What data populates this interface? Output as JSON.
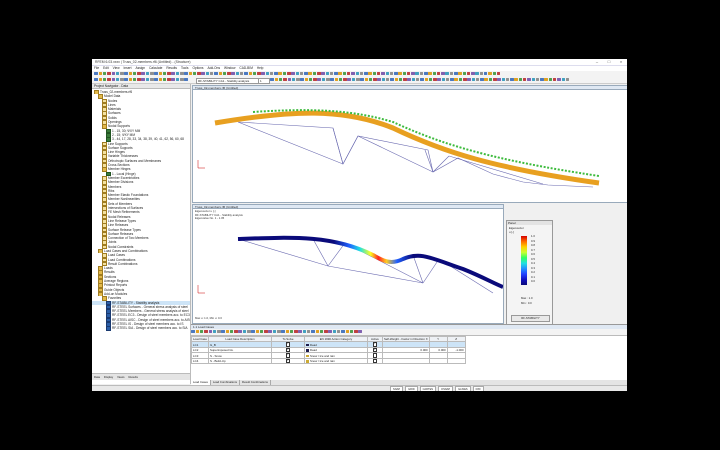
{
  "window": {
    "title": "RFEM 6.03.xxxx | Truss_02-members.rf6 (Untitled) - (Structure)"
  },
  "menu": [
    "File",
    "Edit",
    "View",
    "Insert",
    "Assign",
    "Calculate",
    "Results",
    "Tools",
    "Options",
    "Add-Ons",
    "Window",
    "CAD-BIM",
    "Help"
  ],
  "toolbar": {
    "combo1": "RF-STABILITY CA1 - Stability analysis",
    "combo2": "1"
  },
  "navigator": {
    "title": "Project Navigator - Data",
    "items": [
      {
        "label": "Truss_02-members.rf6",
        "indent": 0,
        "kind": "folder"
      },
      {
        "label": "Model Data",
        "indent": 1,
        "kind": "folder"
      },
      {
        "label": "Nodes",
        "indent": 2,
        "kind": "item"
      },
      {
        "label": "Lines",
        "indent": 2,
        "kind": "item"
      },
      {
        "label": "Materials",
        "indent": 2,
        "kind": "item"
      },
      {
        "label": "Surfaces",
        "indent": 2,
        "kind": "item"
      },
      {
        "label": "Solids",
        "indent": 2,
        "kind": "item"
      },
      {
        "label": "Openings",
        "indent": 2,
        "kind": "item"
      },
      {
        "label": "Nodal Supports",
        "indent": 2,
        "kind": "folder"
      },
      {
        "label": "1 - 15, 30; ΨXY MM",
        "indent": 3,
        "kind": "support"
      },
      {
        "label": "2 - 15; ΨXY MM",
        "indent": 3,
        "kind": "support"
      },
      {
        "label": "3 - 44, 17, 28, 33, 34, 38, 39, 40, 41, 62, 56, 60, 68",
        "indent": 3,
        "kind": "support"
      },
      {
        "label": "Line Supports",
        "indent": 2,
        "kind": "item"
      },
      {
        "label": "Surface Supports",
        "indent": 2,
        "kind": "item"
      },
      {
        "label": "Line Hinges",
        "indent": 2,
        "kind": "item"
      },
      {
        "label": "Variable Thicknesses",
        "indent": 2,
        "kind": "item"
      },
      {
        "label": "Orthotropic Surfaces and Membranes",
        "indent": 2,
        "kind": "item"
      },
      {
        "label": "Cross-Sections",
        "indent": 2,
        "kind": "item"
      },
      {
        "label": "Member Hinges",
        "indent": 2,
        "kind": "folder"
      },
      {
        "label": "1 - Local (Hinge)",
        "indent": 3,
        "kind": "support"
      },
      {
        "label": "Member Eccentricities",
        "indent": 2,
        "kind": "item"
      },
      {
        "label": "Member Divisions",
        "indent": 2,
        "kind": "item"
      },
      {
        "label": "Members",
        "indent": 2,
        "kind": "item"
      },
      {
        "label": "Ribs",
        "indent": 2,
        "kind": "item"
      },
      {
        "label": "Member Elastic Foundations",
        "indent": 2,
        "kind": "item"
      },
      {
        "label": "Member Nonlinearities",
        "indent": 2,
        "kind": "item"
      },
      {
        "label": "Sets of Members",
        "indent": 2,
        "kind": "item"
      },
      {
        "label": "Intersections of Surfaces",
        "indent": 2,
        "kind": "item"
      },
      {
        "label": "FE Mesh Refinements",
        "indent": 2,
        "kind": "item"
      },
      {
        "label": "Nodal Releases",
        "indent": 2,
        "kind": "item"
      },
      {
        "label": "Line Release Types",
        "indent": 2,
        "kind": "item"
      },
      {
        "label": "Line Releases",
        "indent": 2,
        "kind": "item"
      },
      {
        "label": "Surface Release Types",
        "indent": 2,
        "kind": "item"
      },
      {
        "label": "Surface Releases",
        "indent": 2,
        "kind": "item"
      },
      {
        "label": "Connection of Two Members",
        "indent": 2,
        "kind": "item"
      },
      {
        "label": "Joints",
        "indent": 2,
        "kind": "item"
      },
      {
        "label": "Nodal Constraints",
        "indent": 2,
        "kind": "item"
      },
      {
        "label": "Load Cases and Combinations",
        "indent": 1,
        "kind": "folder"
      },
      {
        "label": "Load Cases",
        "indent": 2,
        "kind": "item"
      },
      {
        "label": "Load Combinations",
        "indent": 2,
        "kind": "item"
      },
      {
        "label": "Result Combinations",
        "indent": 2,
        "kind": "item"
      },
      {
        "label": "Loads",
        "indent": 1,
        "kind": "folder"
      },
      {
        "label": "Results",
        "indent": 1,
        "kind": "folder"
      },
      {
        "label": "Sections",
        "indent": 1,
        "kind": "folder"
      },
      {
        "label": "Average Regions",
        "indent": 1,
        "kind": "folder"
      },
      {
        "label": "Printout Reports",
        "indent": 1,
        "kind": "folder"
      },
      {
        "label": "Guide Objects",
        "indent": 1,
        "kind": "folder"
      },
      {
        "label": "Add-on Modules",
        "indent": 1,
        "kind": "folder"
      },
      {
        "label": "Favorites",
        "indent": 2,
        "kind": "folder"
      },
      {
        "label": "RF-STABILITY - Stability analysis",
        "indent": 3,
        "kind": "module",
        "selected": true
      },
      {
        "label": "RF-STEEL Surfaces - General stress analysis of steel",
        "indent": 3,
        "kind": "module"
      },
      {
        "label": "RF-STEEL Members - General stress analysis of steel",
        "indent": 3,
        "kind": "module"
      },
      {
        "label": "RF-STEEL EC3 - Design of steel members acc. to EC3",
        "indent": 3,
        "kind": "module"
      },
      {
        "label": "RF-STEEL AISC - Design of steel members acc. to AISC",
        "indent": 3,
        "kind": "module"
      },
      {
        "label": "RF-STEEL IS - Design of steel members acc. to IS",
        "indent": 3,
        "kind": "module"
      },
      {
        "label": "RF-STEEL SIA - Design of steel members acc. to SIA",
        "indent": 3,
        "kind": "module"
      }
    ],
    "tabs": [
      "Data",
      "Display",
      "Views",
      "Results"
    ]
  },
  "view1": {
    "title": "Truss_02-members.rf6 (Untitled)"
  },
  "view2": {
    "title": "Truss_02-members.rf6 (Untitled)",
    "info": [
      "Eigenvector u [-]",
      "RF-STABILITY CA1 - Stability analysis",
      "Eigenvalue No. 1 - 1.05"
    ],
    "max_text": "Max u: 1.0, Min u: 0.0"
  },
  "panel": {
    "title": "Panel",
    "subtitle": "Eigenvector",
    "unit": "u [-]",
    "legend": [
      "1.0",
      "0.9",
      "0.8",
      "0.7",
      "0.6",
      "0.5",
      "0.4",
      "0.3",
      "0.2",
      "0.1",
      "0.0"
    ],
    "max_label": "Max :",
    "max_val": "1.0",
    "min_label": "Min :",
    "min_val": "0.0",
    "button": "RF-STABILITY"
  },
  "table": {
    "title": "1.1 Load Cases",
    "columns": [
      "Load Case",
      "Load Case Description",
      "To Solve",
      "EN 1990 Action Category",
      "Active",
      "Self-Weight - Factor in Direction X",
      "Y",
      "Z"
    ],
    "rows": [
      {
        "lc": "LC1",
        "desc": "G_B",
        "solve": true,
        "color": "#1c1c4c",
        "cat": "Dead",
        "active": true,
        "x": "",
        "y": "",
        "z": "",
        "selected": true
      },
      {
        "lc": "LC2",
        "desc": "Superimposed GL",
        "solve": true,
        "color": "#1c1c4c",
        "cat": "Dead",
        "active": true,
        "x": "0.000",
        "y": "0.000",
        "z": "-1.000"
      },
      {
        "lc": "LC3",
        "desc": "S - Snow",
        "solve": true,
        "color": "#ccaa33",
        "cat": "Snow / Ice and rain",
        "active": false,
        "x": "",
        "y": "",
        "z": ""
      },
      {
        "lc": "LC4",
        "desc": "S - Build-Up",
        "solve": true,
        "color": "#ccaa33",
        "cat": "Snow / Ice and rain",
        "active": false,
        "x": "",
        "y": "",
        "z": ""
      }
    ]
  },
  "sheet_tabs": [
    "Load Cases",
    "Load Combinations",
    "Result Combinations"
  ],
  "status": [
    "SNAP",
    "GRID",
    "CARTES",
    "OSNAP",
    "GLINES",
    "DXF"
  ]
}
